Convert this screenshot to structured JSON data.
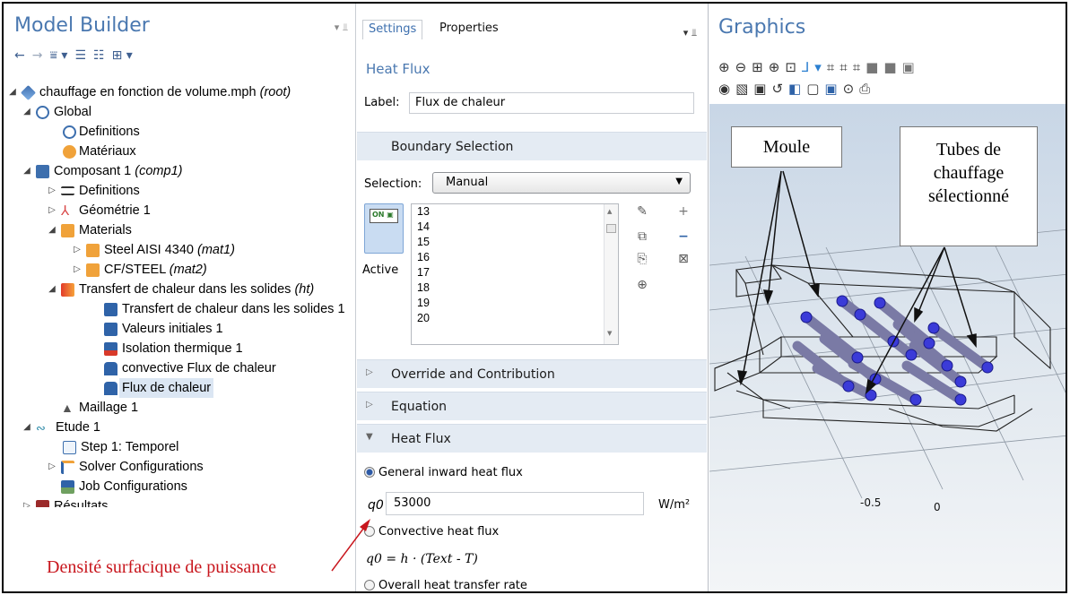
{
  "model_builder": {
    "title": "Model Builder",
    "tree": [
      {
        "label": "chauffage en fonction de volume.mph",
        "tag": "(root)",
        "icon": "root-model-icon"
      },
      {
        "label": "Global",
        "tag": "",
        "icon": "globe-icon"
      },
      {
        "label": "Definitions",
        "tag": "",
        "icon": "definitions-icon"
      },
      {
        "label": "Matériaux",
        "tag": "",
        "icon": "materials-global-icon"
      },
      {
        "label": "Composant 1",
        "tag": "(comp1)",
        "icon": "component-icon"
      },
      {
        "label": "Definitions",
        "tag": "",
        "icon": "definitions-list-icon"
      },
      {
        "label": "Géométrie 1",
        "tag": "",
        "icon": "geometry-icon"
      },
      {
        "label": "Materials",
        "tag": "",
        "icon": "materials-icon"
      },
      {
        "label": "Steel AISI 4340",
        "tag": "(mat1)",
        "icon": "material-icon"
      },
      {
        "label": "CF/STEEL",
        "tag": "(mat2)",
        "icon": "material-icon"
      },
      {
        "label": "Transfert de chaleur dans les solides",
        "tag": "(ht)",
        "icon": "heat-transfer-icon"
      },
      {
        "label": "Transfert de chaleur dans les solides 1",
        "tag": "",
        "icon": "physics-node-icon"
      },
      {
        "label": "Valeurs initiales 1",
        "tag": "",
        "icon": "physics-node-icon"
      },
      {
        "label": "Isolation thermique 1",
        "tag": "",
        "icon": "insulation-icon"
      },
      {
        "label": "convective Flux de chaleur",
        "tag": "",
        "icon": "boundary-icon"
      },
      {
        "label": "Flux de chaleur",
        "tag": "",
        "icon": "boundary-icon"
      },
      {
        "label": "Maillage 1",
        "tag": "",
        "icon": "mesh-icon"
      },
      {
        "label": "Etude 1",
        "tag": "",
        "icon": "study-icon"
      },
      {
        "label": "Step 1: Temporel",
        "tag": "",
        "icon": "step-icon"
      },
      {
        "label": "Solver Configurations",
        "tag": "",
        "icon": "solver-icon"
      },
      {
        "label": "Job Configurations",
        "tag": "",
        "icon": "job-icon"
      },
      {
        "label": "Résultats",
        "tag": "",
        "icon": "results-icon"
      }
    ]
  },
  "settings": {
    "tab_settings": "Settings",
    "tab_properties": "Properties",
    "title": "Heat Flux",
    "label_caption": "Label:",
    "label_value": "Flux de chaleur",
    "boundary_section": "Boundary Selection",
    "selection_caption": "Selection:",
    "selection_value": "Manual",
    "toggle_text": "ON",
    "active_label": "Active",
    "boundaries": [
      "13",
      "14",
      "15",
      "16",
      "17",
      "18",
      "19",
      "20"
    ],
    "override_section": "Override and Contribution",
    "equation_section": "Equation",
    "heat_flux_section": "Heat Flux",
    "radio_general": "General inward heat flux",
    "q0_symbol": "q0",
    "q0_value": "53000",
    "q0_unit": "W/m²",
    "radio_convective": "Convective heat flux",
    "formula": "q0 = h · (Text - T)",
    "radio_overall": "Overall heat transfer rate"
  },
  "graphics": {
    "title": "Graphics",
    "label_moule": "Moule",
    "label_tubes_line1": "Tubes de",
    "label_tubes_line2": "chauffage",
    "label_tubes_line3": "sélectionné",
    "axis_label_1": "-0.5",
    "axis_label_2": "0"
  },
  "annotation": {
    "text": "Densité surfacique de puissance",
    "color": "#c8161d"
  }
}
